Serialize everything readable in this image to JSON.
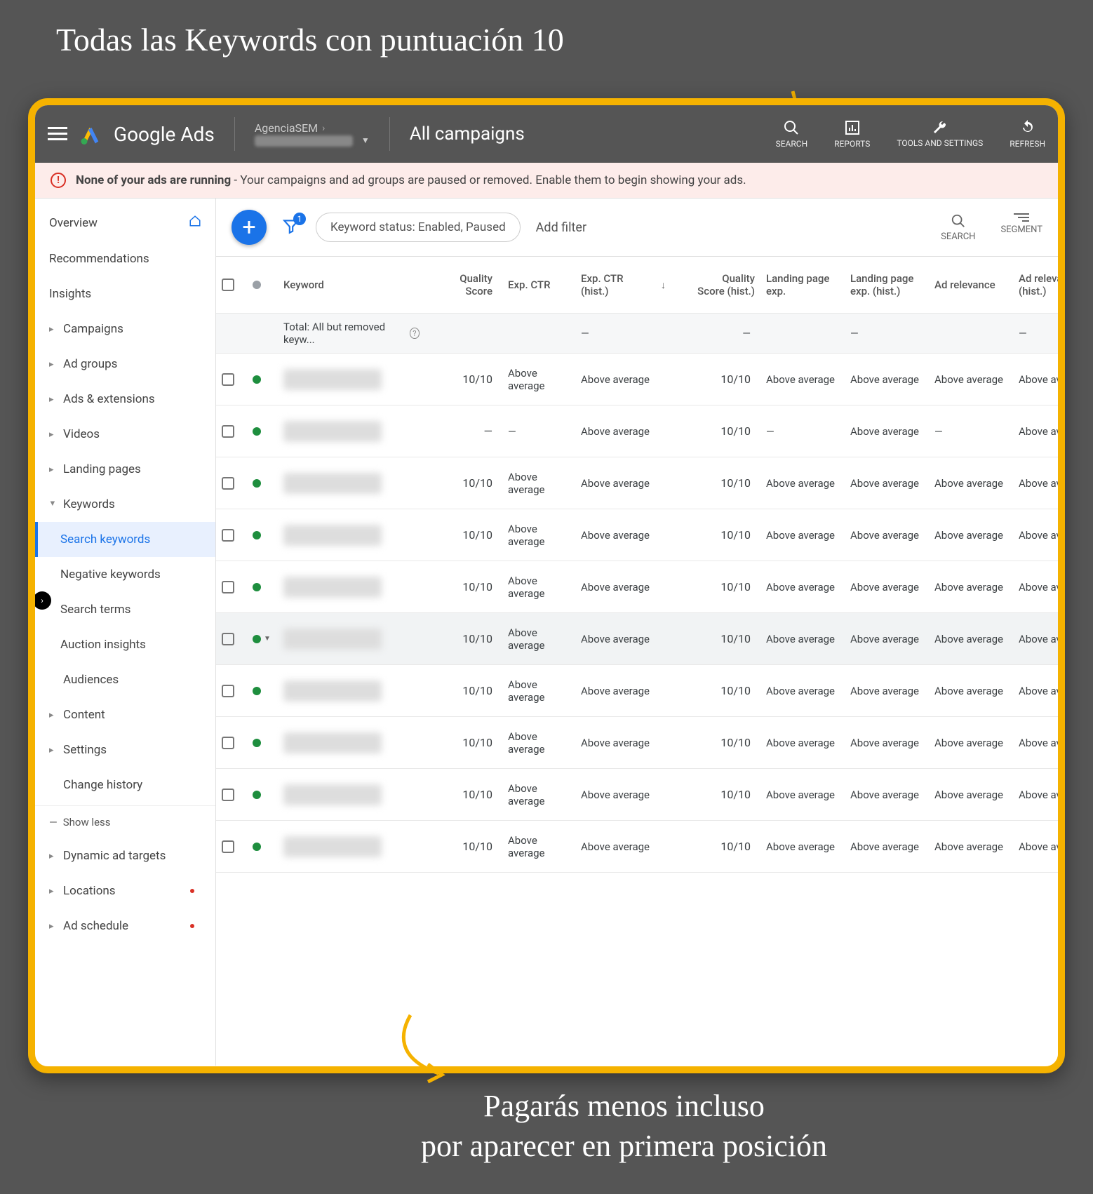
{
  "annotations": {
    "top": "Todas las Keywords con puntuación 10",
    "bottom_line1": "Pagarás menos incluso",
    "bottom_line2": "por aparecer en primera posición"
  },
  "topbar": {
    "brand": "Google Ads",
    "account_name": "AgenciaSEM",
    "page_title": "All campaigns",
    "icons": {
      "search": "SEARCH",
      "reports": "REPORTS",
      "tools": "TOOLS AND SETTINGS",
      "refresh": "REFRESH"
    }
  },
  "warning": {
    "bold": "None of your ads are running",
    "rest": " - Your campaigns and ad groups are paused or removed. Enable them to begin showing your ads."
  },
  "sidebar": {
    "overview": "Overview",
    "recommendations": "Recommendations",
    "insights": "Insights",
    "campaigns": "Campaigns",
    "adgroups": "Ad groups",
    "adsext": "Ads & extensions",
    "videos": "Videos",
    "landing": "Landing pages",
    "keywords": "Keywords",
    "search_keywords": "Search keywords",
    "negative_keywords": "Negative keywords",
    "search_terms": "Search terms",
    "auction": "Auction insights",
    "audiences": "Audiences",
    "content": "Content",
    "settings": "Settings",
    "change_history": "Change history",
    "show_less": "Show less",
    "dynamic": "Dynamic ad targets",
    "locations": "Locations",
    "adschedule": "Ad schedule"
  },
  "toolbar": {
    "filter_badge": "1",
    "chip": "Keyword status: Enabled, Paused",
    "add_filter": "Add filter",
    "search": "SEARCH",
    "segment": "SEGMENT"
  },
  "table": {
    "headers": {
      "keyword": "Keyword",
      "quality_score": "Quality Score",
      "exp_ctr": "Exp. CTR",
      "exp_ctr_hist": "Exp. CTR (hist.)",
      "quality_score_hist": "Quality Score (hist.)",
      "landing_exp": "Landing page exp.",
      "landing_exp_hist": "Landing page exp. (hist.)",
      "ad_rel": "Ad relevance",
      "ad_rel_hist": "Ad relevance (hist.)"
    },
    "total_label": "Total: All but removed keyw...",
    "dash": "—",
    "rows": [
      {
        "qs": "10/10",
        "ctr": "Above average",
        "ctrh": "Above average",
        "qsh": "10/10",
        "lp": "Above average",
        "lph": "Above average",
        "ar": "Above average",
        "arh": "Above average",
        "sel": false
      },
      {
        "qs": "—",
        "ctr": "—",
        "ctrh": "Above average",
        "qsh": "10/10",
        "lp": "—",
        "lph": "Above average",
        "ar": "—",
        "arh": "Above average",
        "sel": false
      },
      {
        "qs": "10/10",
        "ctr": "Above average",
        "ctrh": "Above average",
        "qsh": "10/10",
        "lp": "Above average",
        "lph": "Above average",
        "ar": "Above average",
        "arh": "Above average",
        "sel": false
      },
      {
        "qs": "10/10",
        "ctr": "Above average",
        "ctrh": "Above average",
        "qsh": "10/10",
        "lp": "Above average",
        "lph": "Above average",
        "ar": "Above average",
        "arh": "Above average",
        "sel": false
      },
      {
        "qs": "10/10",
        "ctr": "Above average",
        "ctrh": "Above average",
        "qsh": "10/10",
        "lp": "Above average",
        "lph": "Above average",
        "ar": "Above average",
        "arh": "Above average",
        "sel": false
      },
      {
        "qs": "10/10",
        "ctr": "Above average",
        "ctrh": "Above average",
        "qsh": "10/10",
        "lp": "Above average",
        "lph": "Above average",
        "ar": "Above average",
        "arh": "Above average",
        "sel": true,
        "caret": true
      },
      {
        "qs": "10/10",
        "ctr": "Above average",
        "ctrh": "Above average",
        "qsh": "10/10",
        "lp": "Above average",
        "lph": "Above average",
        "ar": "Above average",
        "arh": "Above average",
        "sel": false
      },
      {
        "qs": "10/10",
        "ctr": "Above average",
        "ctrh": "Above average",
        "qsh": "10/10",
        "lp": "Above average",
        "lph": "Above average",
        "ar": "Above average",
        "arh": "Above average",
        "sel": false
      },
      {
        "qs": "10/10",
        "ctr": "Above average",
        "ctrh": "Above average",
        "qsh": "10/10",
        "lp": "Above average",
        "lph": "Above average",
        "ar": "Above average",
        "arh": "Above average",
        "sel": false
      },
      {
        "qs": "10/10",
        "ctr": "Above average",
        "ctrh": "Above average",
        "qsh": "10/10",
        "lp": "Above average",
        "lph": "Above average",
        "ar": "Above average",
        "arh": "Above average",
        "sel": false
      }
    ]
  }
}
